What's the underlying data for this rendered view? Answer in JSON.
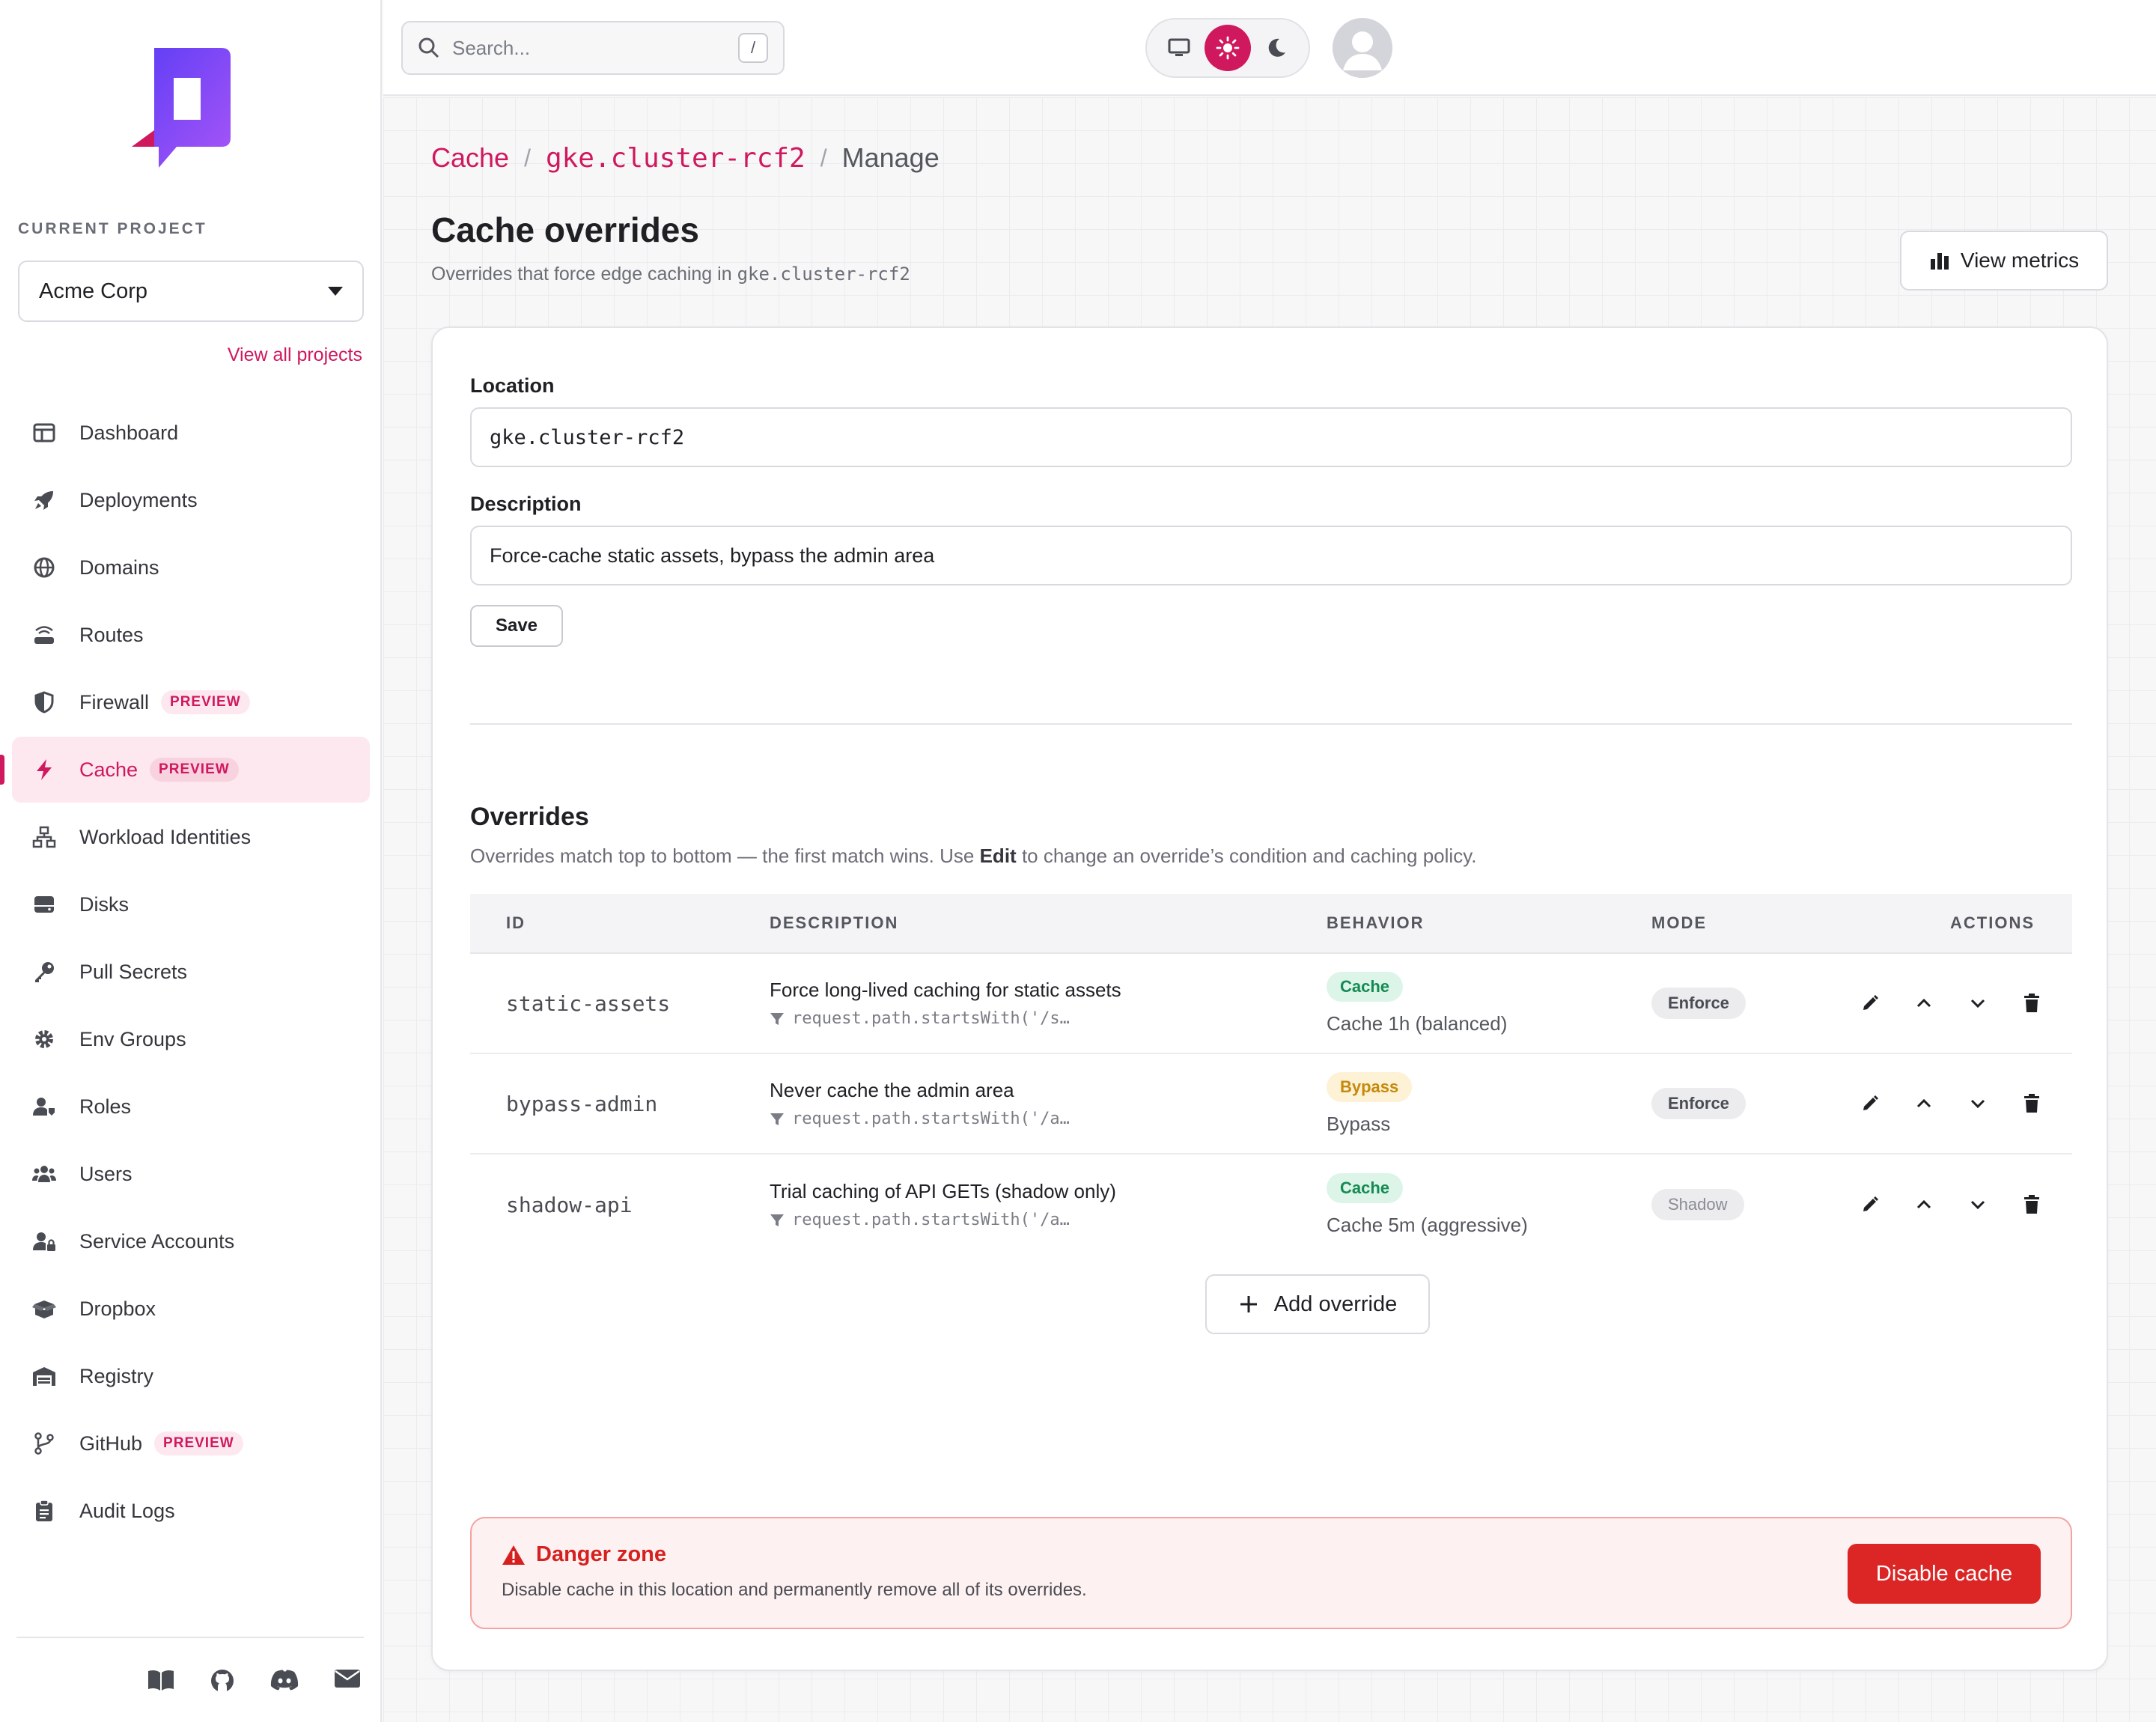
{
  "sidebar": {
    "project_label": "CURRENT PROJECT",
    "project_name": "Acme Corp",
    "view_all": "View all projects",
    "items": [
      {
        "label": "Dashboard",
        "icon": "dashboard-icon"
      },
      {
        "label": "Deployments",
        "icon": "rocket-icon"
      },
      {
        "label": "Domains",
        "icon": "globe-icon"
      },
      {
        "label": "Routes",
        "icon": "router-icon"
      },
      {
        "label": "Firewall",
        "icon": "shield-icon",
        "badge": "PREVIEW"
      },
      {
        "label": "Cache",
        "icon": "bolt-icon",
        "badge": "PREVIEW",
        "active": true
      },
      {
        "label": "Workload Identities",
        "icon": "network-icon"
      },
      {
        "label": "Disks",
        "icon": "disk-icon"
      },
      {
        "label": "Pull Secrets",
        "icon": "key-icon"
      },
      {
        "label": "Env Groups",
        "icon": "gear-icon"
      },
      {
        "label": "Roles",
        "icon": "user-tag-icon"
      },
      {
        "label": "Users",
        "icon": "users-icon"
      },
      {
        "label": "Service Accounts",
        "icon": "user-lock-icon"
      },
      {
        "label": "Dropbox",
        "icon": "box-icon"
      },
      {
        "label": "Registry",
        "icon": "warehouse-icon"
      },
      {
        "label": "GitHub",
        "icon": "branch-icon",
        "badge": "PREVIEW"
      },
      {
        "label": "Audit Logs",
        "icon": "clipboard-icon"
      }
    ],
    "footer_icons": [
      "book-icon",
      "github-icon",
      "discord-icon",
      "mail-icon"
    ]
  },
  "topbar": {
    "search_placeholder": "Search...",
    "search_shortcut": "/",
    "theme_options": [
      "desktop-icon",
      "sun-icon",
      "moon-icon"
    ],
    "theme_selected": "sun-icon"
  },
  "breadcrumb": {
    "root": "Cache",
    "location": "gke.cluster-rcf2",
    "current": "Manage",
    "separator": "/"
  },
  "page": {
    "title": "Cache overrides",
    "subtitle_prefix": "Overrides that force edge caching in",
    "subtitle_location": "gke.cluster-rcf2",
    "metrics_button": "View metrics"
  },
  "form": {
    "location_label": "Location",
    "location_value": "gke.cluster-rcf2",
    "description_label": "Description",
    "description_value": "Force-cache static assets, bypass the admin area",
    "save_label": "Save"
  },
  "overrides": {
    "title": "Overrides",
    "subtitle_before": "Overrides match top to bottom — the first match wins. Use",
    "subtitle_bold": "Edit",
    "subtitle_after": "to change an override’s condition and caching policy.",
    "columns": [
      "ID",
      "DESCRIPTION",
      "BEHAVIOR",
      "MODE",
      "ACTIONS"
    ],
    "rows": [
      {
        "id": "static-assets",
        "description": "Force long-lived caching for static assets",
        "condition": "request.path.startsWith('/s…",
        "behavior": "Cache",
        "behavior_detail": "Cache 1h (balanced)",
        "mode": "Enforce"
      },
      {
        "id": "bypass-admin",
        "description": "Never cache the admin area",
        "condition": "request.path.startsWith('/a…",
        "behavior": "Bypass",
        "behavior_detail": "Bypass",
        "mode": "Enforce"
      },
      {
        "id": "shadow-api",
        "description": "Trial caching of API GETs (shadow only)",
        "condition": "request.path.startsWith('/a…",
        "behavior": "Cache",
        "behavior_detail": "Cache 5m (aggressive)",
        "mode": "Shadow"
      }
    ],
    "add_label": "Add override"
  },
  "danger": {
    "title": "Danger zone",
    "subtitle": "Disable cache in this location and permanently remove all of its overrides.",
    "button": "Disable cache"
  },
  "colors": {
    "accent": "#d0185e",
    "danger": "#dc2626",
    "cache_green": "#158a54",
    "bypass_amber": "#c58a0b"
  }
}
